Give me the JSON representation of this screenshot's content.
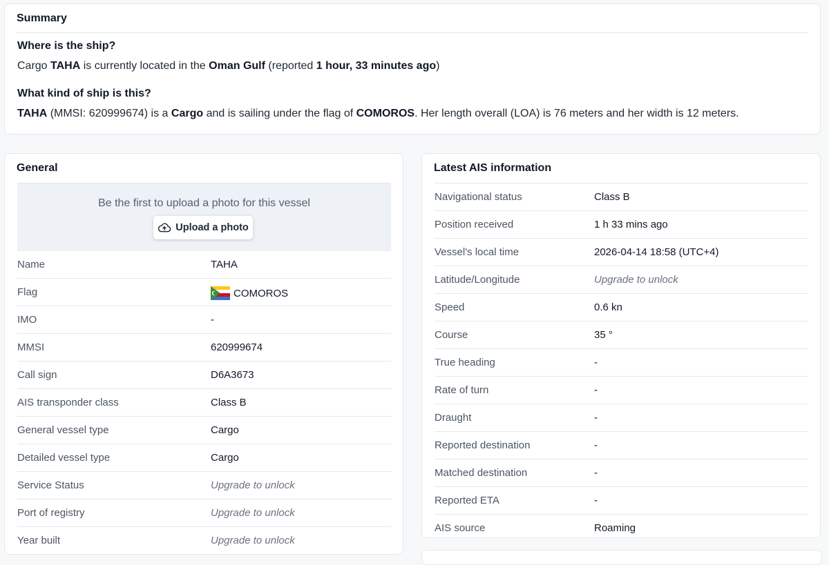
{
  "summary": {
    "title": "Summary",
    "q1": "Where is the ship?",
    "a1": {
      "p1": "Cargo ",
      "b1": "TAHA",
      "p2": " is currently located in the ",
      "b2": "Oman Gulf",
      "p3": " (reported ",
      "b3": "1 hour, 33 minutes ago",
      "p4": ")"
    },
    "q2": "What kind of ship is this?",
    "a2": {
      "b1": "TAHA",
      "p1": " (MMSI: 620999674) is a ",
      "b2": "Cargo",
      "p2": " and is sailing under the flag of ",
      "b3": "COMOROS",
      "p3": ". Her length overall (LOA) is 76 meters and her width is 12 meters."
    }
  },
  "general": {
    "title": "General",
    "photo_prompt": "Be the first to upload a photo for this vessel",
    "upload_label": "Upload a photo",
    "rows": [
      {
        "label": "Name",
        "value": "TAHA"
      },
      {
        "label": "Flag",
        "value": "COMOROS",
        "icon": "comoros-flag-icon"
      },
      {
        "label": "IMO",
        "value": "-"
      },
      {
        "label": "MMSI",
        "value": "620999674"
      },
      {
        "label": "Call sign",
        "value": "D6A3673"
      },
      {
        "label": "AIS transponder class",
        "value": "Class B"
      },
      {
        "label": "General vessel type",
        "value": "Cargo"
      },
      {
        "label": "Detailed vessel type",
        "value": "Cargo"
      },
      {
        "label": "Service Status",
        "value": "Upgrade to unlock",
        "locked": true
      },
      {
        "label": "Port of registry",
        "value": "Upgrade to unlock",
        "locked": true
      },
      {
        "label": "Year built",
        "value": "Upgrade to unlock",
        "locked": true
      }
    ]
  },
  "ais": {
    "title": "Latest AIS information",
    "rows": [
      {
        "label": "Navigational status",
        "value": "Class B"
      },
      {
        "label": "Position received",
        "value": "1 h 33 mins ago"
      },
      {
        "label": "Vessel's local time",
        "value": "2026-04-14 18:58 (UTC+4)"
      },
      {
        "label": "Latitude/Longitude",
        "value": "Upgrade to unlock",
        "locked": true
      },
      {
        "label": "Speed",
        "value": "0.6 kn"
      },
      {
        "label": "Course",
        "value": "35 °"
      },
      {
        "label": "True heading",
        "value": "-"
      },
      {
        "label": "Rate of turn",
        "value": "-"
      },
      {
        "label": "Draught",
        "value": "-"
      },
      {
        "label": "Reported destination",
        "value": "-"
      },
      {
        "label": "Matched destination",
        "value": "-"
      },
      {
        "label": "Reported ETA",
        "value": "-"
      },
      {
        "label": "AIS source",
        "value": "Roaming"
      }
    ]
  },
  "colors": {
    "locked_text": "#6b7280",
    "photo_bg": "#eef1f6"
  }
}
